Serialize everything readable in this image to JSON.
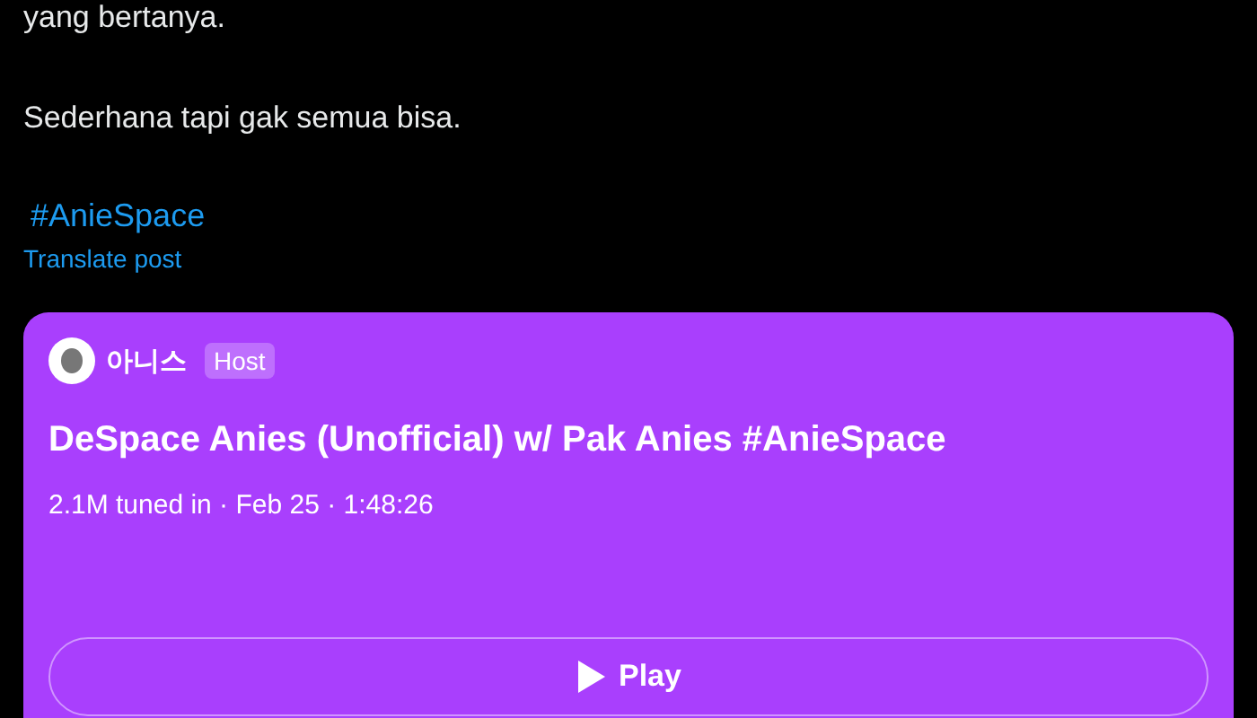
{
  "post": {
    "paragraphs": [
      "yang bertanya.",
      "Sederhana tapi gak semua bisa."
    ],
    "hashtag": "#AnieSpace",
    "translate": "Translate post"
  },
  "space": {
    "host_name": "아니스",
    "host_badge": "Host",
    "title": "DeSpace Anies (Unofficial) w/ Pak Anies #AnieSpace",
    "meta": "2.1M tuned in · Feb 25 · 1:48:26",
    "button": "Play"
  }
}
